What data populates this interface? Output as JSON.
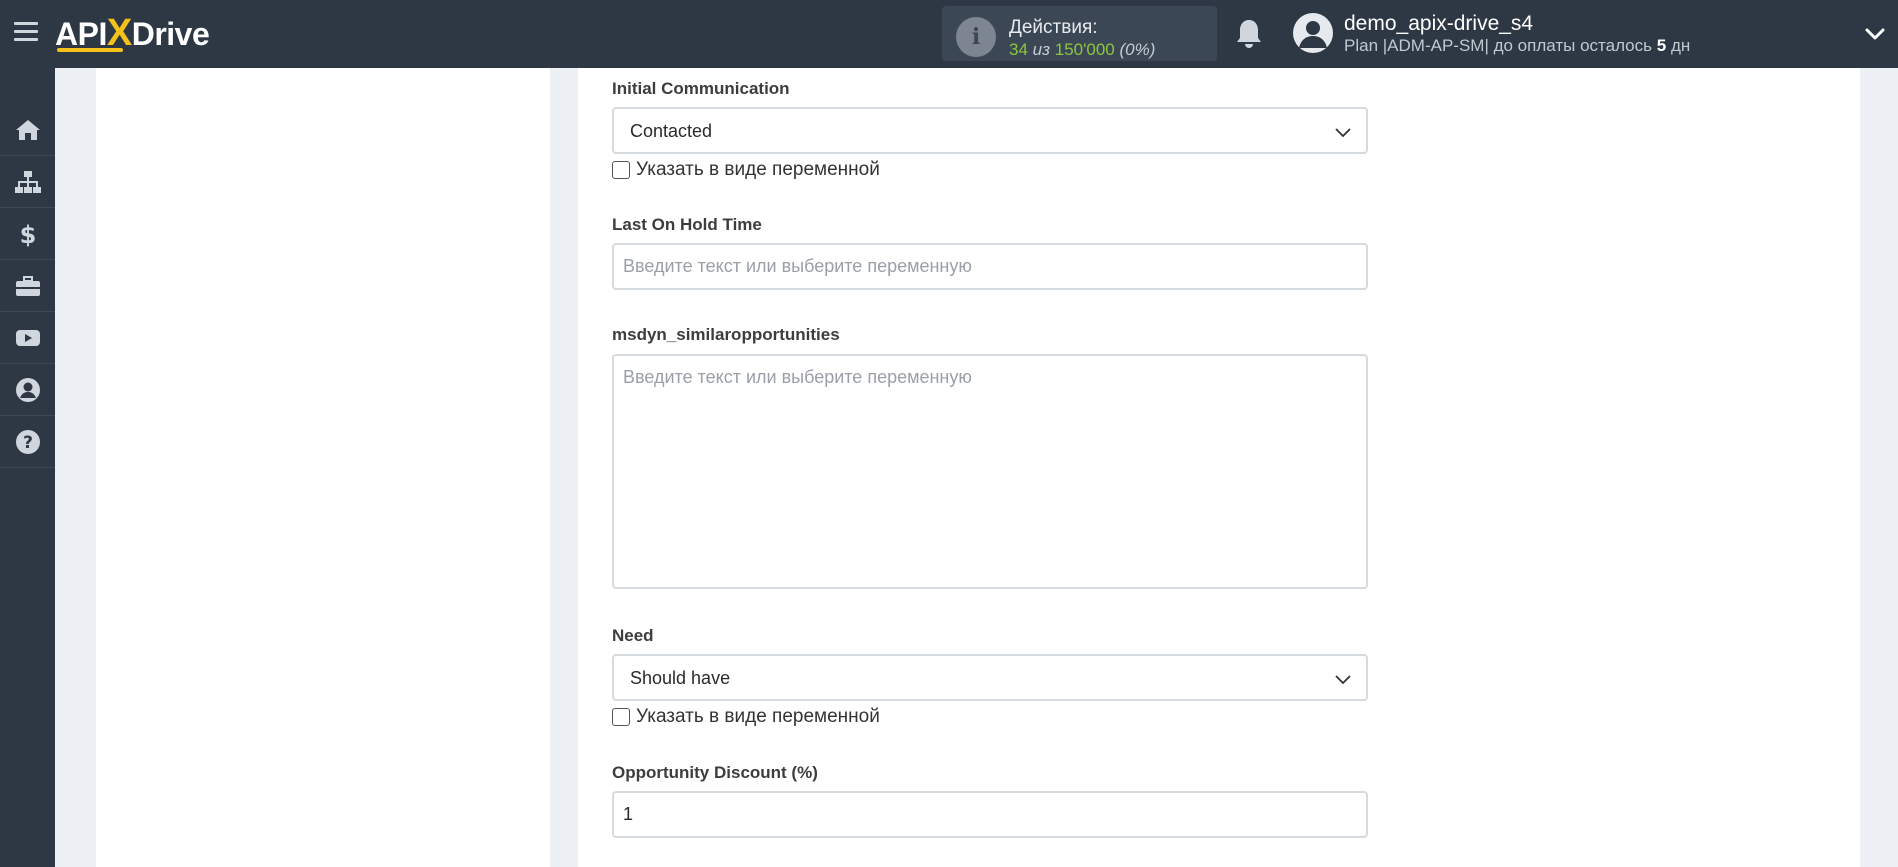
{
  "header": {
    "logo_api": "API",
    "logo_x": "X",
    "logo_drive": "Drive",
    "actions_title": "Действия:",
    "actions_used": "34",
    "actions_of": "из",
    "actions_total": "150'000",
    "actions_percent": "(0%)",
    "user_name": "demo_apix-drive_s4",
    "plan_prefix": "Plan |ADM-AP-SM| до оплаты осталось",
    "plan_days": "5",
    "plan_unit": "дн"
  },
  "sidebar": {
    "items": [
      {
        "icon": "home-icon"
      },
      {
        "icon": "sitemap-icon"
      },
      {
        "icon": "dollar-icon"
      },
      {
        "icon": "briefcase-icon"
      },
      {
        "icon": "youtube-icon"
      },
      {
        "icon": "user-circle-icon"
      },
      {
        "icon": "help-icon"
      }
    ]
  },
  "form": {
    "initial_communication": {
      "label": "Initial Communication",
      "value": "Contacted",
      "checkbox_label": "Указать в виде переменной"
    },
    "last_on_hold_time": {
      "label": "Last On Hold Time",
      "placeholder": "Введите текст или выберите переменную",
      "value": ""
    },
    "similar_opportunities": {
      "label": "msdyn_similaropportunities",
      "placeholder": "Введите текст или выберите переменную",
      "value": ""
    },
    "need": {
      "label": "Need",
      "value": "Should have",
      "checkbox_label": "Указать в виде переменной"
    },
    "opportunity_discount": {
      "label": "Opportunity Discount (%)",
      "value": "1"
    }
  },
  "colors": {
    "topbar": "#2d3844",
    "accent_yellow": "#f6c21a",
    "accent_green": "#8dc63f",
    "background": "#edf0f4"
  }
}
